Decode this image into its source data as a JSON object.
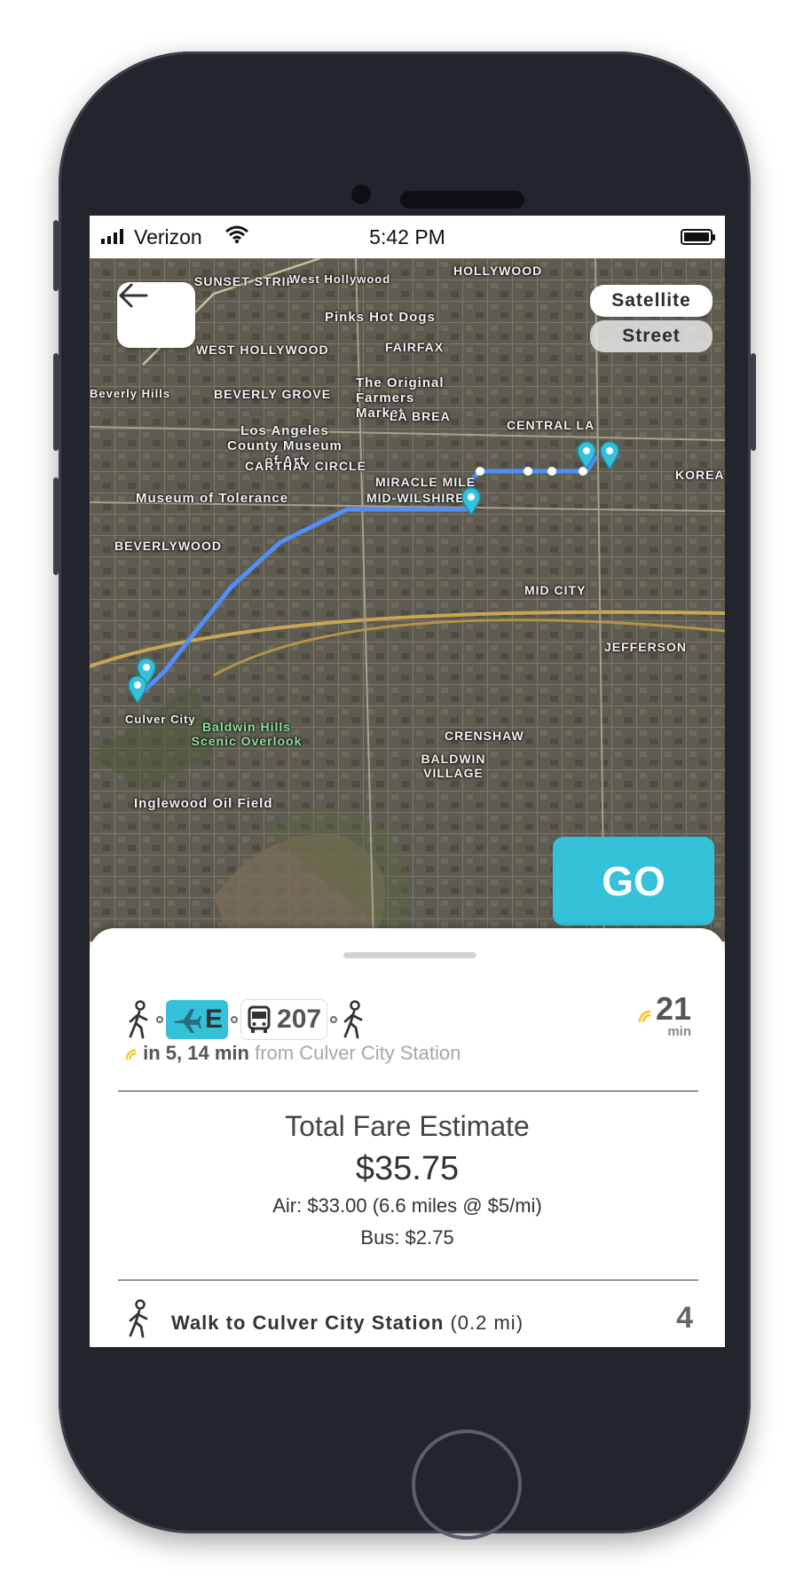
{
  "status_bar": {
    "carrier": "Verizon",
    "time": "5:42 PM"
  },
  "map": {
    "layer_options": [
      "Satellite",
      "Street"
    ],
    "go_label": "GO",
    "labels": [
      "SUNSET STRIP",
      "West Hollywood",
      "HOLLYWOOD",
      "Pinks Hot Dogs",
      "WEST HOLLYWOOD",
      "FAIRFAX",
      "Beverly Hills",
      "BEVERLY GROVE",
      "The Original Farmers Market",
      "LA BREA",
      "CENTRAL LA",
      "Los Angeles County Museum of Art",
      "CARTHAY CIRCLE",
      "MIRACLE MILE",
      "MID-WILSHIRE",
      "KOREA",
      "Museum of Tolerance",
      "BEVERLYWOOD",
      "MID CITY",
      "JEFFERSON",
      "Culver City",
      "Baldwin Hills Scenic Overlook",
      "CRENSHAW",
      "BALDWIN VILLAGE",
      "Inglewood Oil Field"
    ]
  },
  "route": {
    "air_line": "E",
    "bus_line": "207",
    "duration": "21",
    "duration_unit": "min",
    "next_prefix": "in 5, 14 min",
    "next_suffix": "from Culver City Station"
  },
  "fare": {
    "title": "Total Fare Estimate",
    "total": "$35.75",
    "air": "Air: $33.00 (6.6 miles @ $5/mi)",
    "bus": "Bus: $2.75"
  },
  "step": {
    "label": "Walk to Culver City Station",
    "distance": "(0.2 mi)",
    "minutes": "4"
  },
  "colors": {
    "accent": "#35c1da",
    "route": "#4f8ff7",
    "realtime": "#f5c518"
  }
}
